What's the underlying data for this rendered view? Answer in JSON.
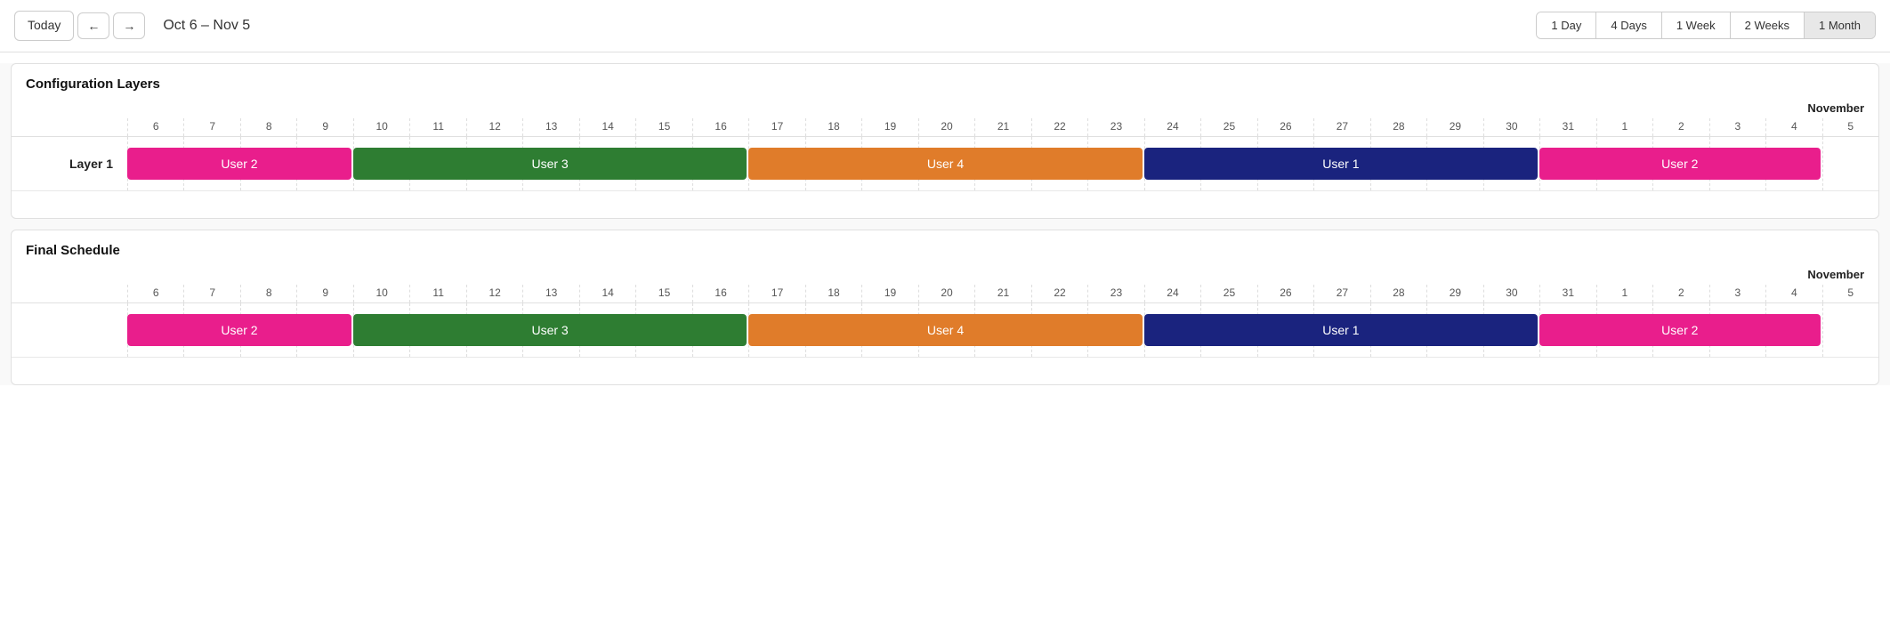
{
  "toolbar": {
    "today_label": "Today",
    "prev_label": "←",
    "next_label": "→",
    "date_range": "Oct 6 – Nov 5",
    "view_buttons": [
      {
        "id": "1day",
        "label": "1 Day",
        "active": false
      },
      {
        "id": "4days",
        "label": "4 Days",
        "active": false
      },
      {
        "id": "1week",
        "label": "1 Week",
        "active": false
      },
      {
        "id": "2weeks",
        "label": "2 Weeks",
        "active": false
      },
      {
        "id": "1month",
        "label": "1 Month",
        "active": true
      }
    ]
  },
  "sections": [
    {
      "id": "config-layers",
      "title": "Configuration Layers",
      "rows": [
        {
          "label": "Layer 1",
          "bars": [
            {
              "label": "User 2",
              "color": "#e91e8c",
              "start": 0,
              "span": 4
            },
            {
              "label": "User 3",
              "color": "#2e7d32",
              "start": 4,
              "span": 7
            },
            {
              "label": "User 4",
              "color": "#e07c2a",
              "start": 11,
              "span": 7
            },
            {
              "label": "User 1",
              "color": "#1a237e",
              "start": 18,
              "span": 7
            },
            {
              "label": "User 2",
              "color": "#e91e8c",
              "start": 25,
              "span": 5
            }
          ]
        }
      ]
    },
    {
      "id": "final-schedule",
      "title": "Final Schedule",
      "rows": [
        {
          "label": null,
          "bars": [
            {
              "label": "User 2",
              "color": "#e91e8c",
              "start": 0,
              "span": 4
            },
            {
              "label": "User 3",
              "color": "#2e7d32",
              "start": 4,
              "span": 7
            },
            {
              "label": "User 4",
              "color": "#e07c2a",
              "start": 11,
              "span": 7
            },
            {
              "label": "User 1",
              "color": "#1a237e",
              "start": 18,
              "span": 7
            },
            {
              "label": "User 2",
              "color": "#e91e8c",
              "start": 25,
              "span": 5
            }
          ]
        }
      ]
    }
  ],
  "days": [
    "6",
    "7",
    "8",
    "9",
    "10",
    "11",
    "12",
    "13",
    "14",
    "15",
    "16",
    "17",
    "18",
    "19",
    "20",
    "21",
    "22",
    "23",
    "24",
    "25",
    "26",
    "27",
    "28",
    "29",
    "30",
    "31",
    "1",
    "2",
    "3",
    "4",
    "5"
  ],
  "november_start_index": 26,
  "november_label": "November",
  "colors": {
    "user1": "#1a237e",
    "user2": "#e91e8c",
    "user3": "#2e7d32",
    "user4": "#e07c2a"
  }
}
